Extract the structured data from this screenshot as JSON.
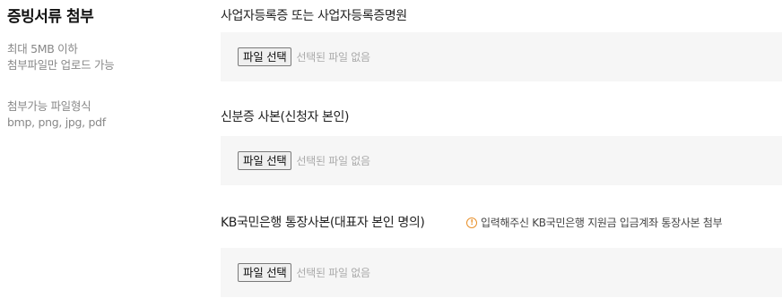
{
  "left": {
    "title": "증빙서류 첨부",
    "size_note": [
      "최대 5MB 이하",
      "첨부파일만 업로드 가능"
    ],
    "format_note": [
      "첨부가능 파일형식",
      "bmp, png, jpg, pdf"
    ]
  },
  "fields": [
    {
      "label": "사업자등록증 또는 사업자등록증명원",
      "button_label": "파일 선택",
      "status": "선택된 파일 없음"
    },
    {
      "label": "신분증 사본(신청자 본인)",
      "button_label": "파일 선택",
      "status": "선택된 파일 없음"
    },
    {
      "label": "KB국민은행 통장사본(대표자 본인 명의)",
      "hint": "입력해주신 KB국민은행 지원금 입금계좌 통장사본 첨부",
      "hint_icon": "info-circle-icon",
      "button_label": "파일 선택",
      "status": "선택된 파일 없음"
    }
  ],
  "colors": {
    "hint_accent": "#e8902a",
    "box_background": "#f6f6f6",
    "muted_text": "#888888"
  }
}
